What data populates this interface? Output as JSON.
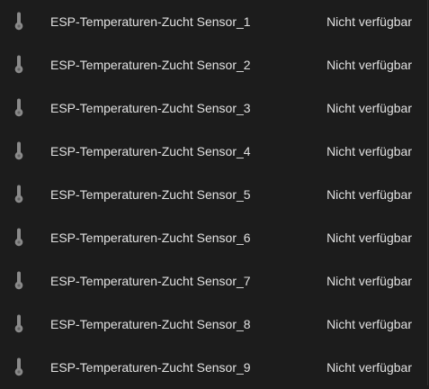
{
  "entities": [
    {
      "name": "ESP-Temperaturen-Zucht Sensor_1",
      "state": "Nicht verfügbar",
      "icon": "thermometer-icon"
    },
    {
      "name": "ESP-Temperaturen-Zucht Sensor_2",
      "state": "Nicht verfügbar",
      "icon": "thermometer-icon"
    },
    {
      "name": "ESP-Temperaturen-Zucht Sensor_3",
      "state": "Nicht verfügbar",
      "icon": "thermometer-icon"
    },
    {
      "name": "ESP-Temperaturen-Zucht Sensor_4",
      "state": "Nicht verfügbar",
      "icon": "thermometer-icon"
    },
    {
      "name": "ESP-Temperaturen-Zucht Sensor_5",
      "state": "Nicht verfügbar",
      "icon": "thermometer-icon"
    },
    {
      "name": "ESP-Temperaturen-Zucht Sensor_6",
      "state": "Nicht verfügbar",
      "icon": "thermometer-icon"
    },
    {
      "name": "ESP-Temperaturen-Zucht Sensor_7",
      "state": "Nicht verfügbar",
      "icon": "thermometer-icon"
    },
    {
      "name": "ESP-Temperaturen-Zucht Sensor_8",
      "state": "Nicht verfügbar",
      "icon": "thermometer-icon"
    },
    {
      "name": "ESP-Temperaturen-Zucht Sensor_9",
      "state": "Nicht verfügbar",
      "icon": "thermometer-icon"
    }
  ],
  "colors": {
    "background": "#1c1c1c",
    "text": "#e1e1e1",
    "icon": "#8a8a8a"
  }
}
